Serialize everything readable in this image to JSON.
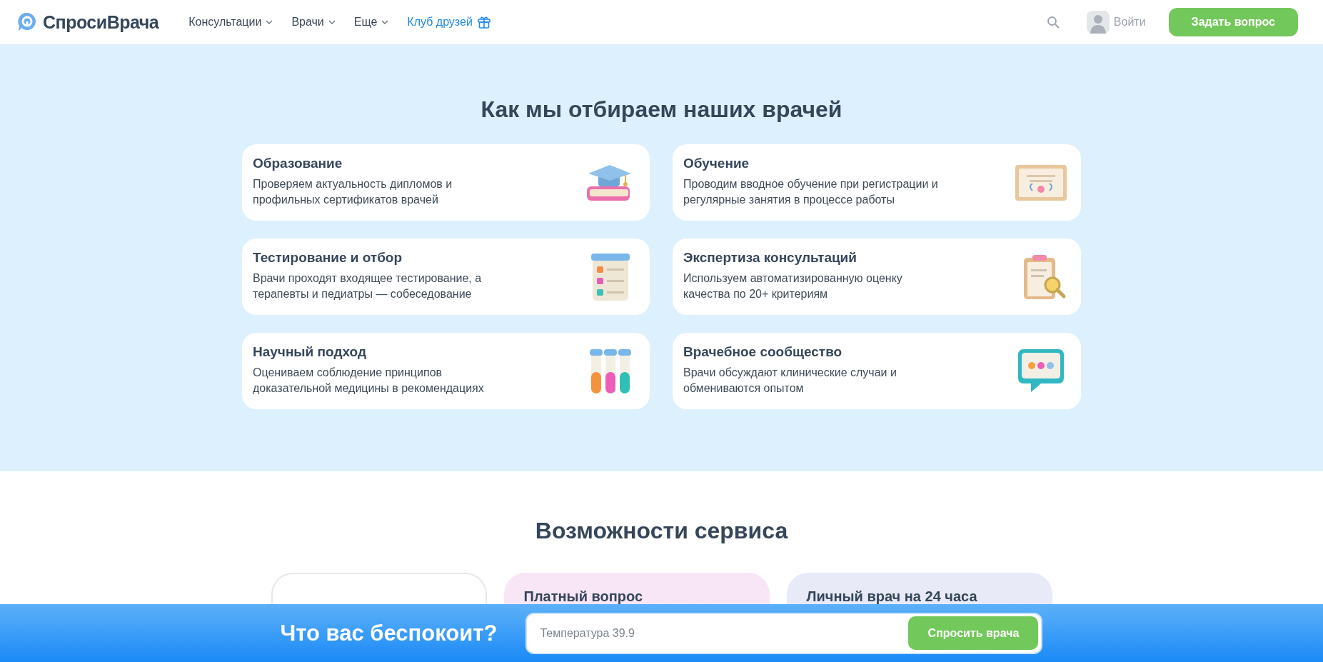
{
  "header": {
    "logo": "СпросиВрача",
    "nav": [
      {
        "label": "Консультации",
        "kind": "dropdown"
      },
      {
        "label": "Врачи",
        "kind": "dropdown"
      },
      {
        "label": "Еще",
        "kind": "dropdown"
      },
      {
        "label": "Клуб друзей",
        "kind": "gift"
      }
    ],
    "login": "Войти",
    "cta": "Задать вопрос"
  },
  "selection": {
    "title": "Как мы отбираем наших врачей",
    "cards": [
      {
        "title": "Образование",
        "text": "Проверяем актуальность дипломов и профильных сертификатов врачей",
        "kind": "cap"
      },
      {
        "title": "Обучение",
        "text": "Проводим вводное обучение при регистрации и регулярные занятия в процессе работы",
        "kind": "diploma"
      },
      {
        "title": "Тестирование и отбор",
        "text": "Врачи проходят входящее тестирование, а терапевты и педиатры — собеседование",
        "kind": "checklist"
      },
      {
        "title": "Экспертиза консультаций",
        "text": "Используем автоматизированную оценку качества по 20+ критериям",
        "kind": "clipboard"
      },
      {
        "title": "Научный подход",
        "text": "Оцениваем соблюдение принципов доказательной медицины в рекомендациях",
        "kind": "tubes"
      },
      {
        "title": "Врачебное сообщество",
        "text": "Врачи обсуждают клинические случаи и обмениваются опытом",
        "kind": "chat"
      }
    ]
  },
  "features": {
    "title": "Возможности сервиса",
    "cards": [
      {
        "color": "#ffffff"
      },
      {
        "title": "Платный вопрос",
        "color": "#f8e6f6"
      },
      {
        "title": "Личный врач на 24 часа",
        "color": "#e8eaf8"
      }
    ]
  },
  "ask_bar": {
    "title": "Что вас беспокоит?",
    "placeholder": "Температура 39.9",
    "button": "Спросить врача"
  }
}
